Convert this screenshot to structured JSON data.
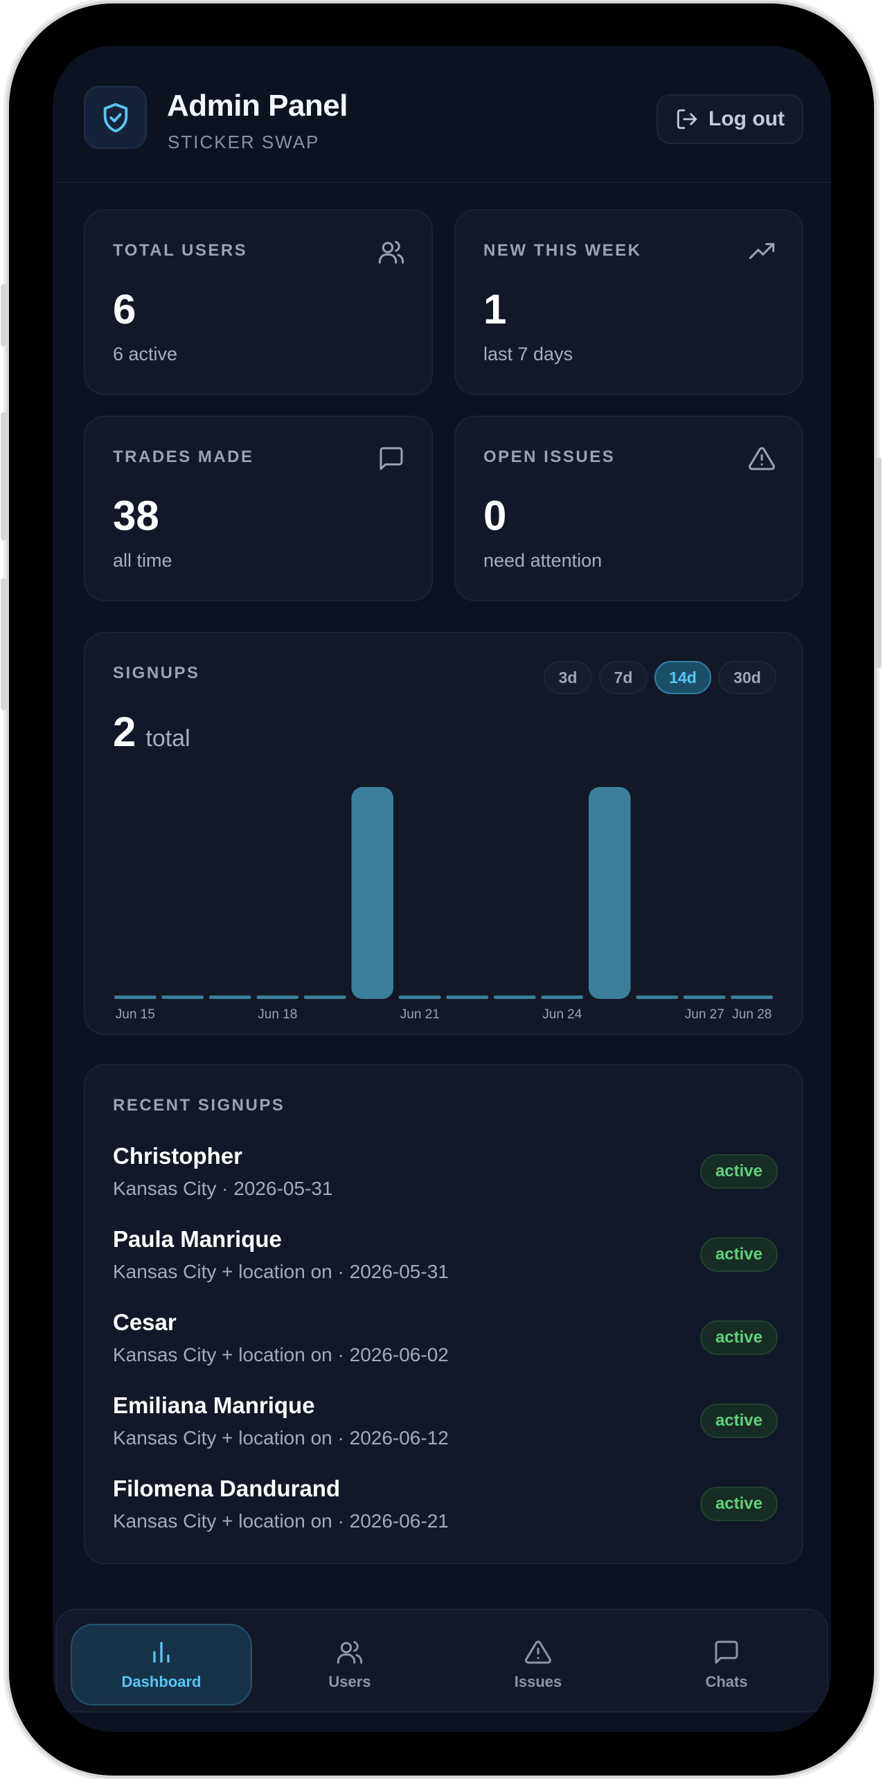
{
  "header": {
    "title": "Admin Panel",
    "subtitle": "STICKER SWAP",
    "logout_label": "Log out"
  },
  "stats": [
    {
      "label": "TOTAL USERS",
      "value": "6",
      "sub": "6 active",
      "icon": "users-icon"
    },
    {
      "label": "NEW THIS WEEK",
      "value": "1",
      "sub": "last 7 days",
      "icon": "trending-up-icon"
    },
    {
      "label": "TRADES MADE",
      "value": "38",
      "sub": "all time",
      "icon": "chat-icon"
    },
    {
      "label": "OPEN ISSUES",
      "value": "0",
      "sub": "need attention",
      "icon": "alert-triangle-icon"
    }
  ],
  "signups": {
    "label": "SIGNUPS",
    "ranges": [
      "3d",
      "7d",
      "14d",
      "30d"
    ],
    "selected_range": "14d",
    "total_value": "2",
    "total_word": "total"
  },
  "chart_data": {
    "type": "bar",
    "categories": [
      "Jun 15",
      "Jun 16",
      "Jun 17",
      "Jun 18",
      "Jun 19",
      "Jun 20",
      "Jun 21",
      "Jun 22",
      "Jun 23",
      "Jun 24",
      "Jun 25",
      "Jun 26",
      "Jun 27",
      "Jun 28"
    ],
    "values": [
      0,
      0,
      0,
      0,
      0,
      1,
      0,
      0,
      0,
      0,
      1,
      0,
      0,
      0
    ],
    "tick_labels": [
      "Jun 15",
      "Jun 18",
      "Jun 21",
      "Jun 24",
      "Jun 27",
      "Jun 28"
    ],
    "tick_indices": [
      0,
      3,
      6,
      9,
      12,
      13
    ],
    "ylim": [
      0,
      1
    ],
    "bar_color": "#3b7f9b",
    "grid": false
  },
  "recent_signups": {
    "label": "RECENT SIGNUPS",
    "items": [
      {
        "name": "Christopher",
        "meta": "Kansas City · 2026-05-31",
        "status": "active"
      },
      {
        "name": "Paula Manrique",
        "meta": "Kansas City + location on · 2026-05-31",
        "status": "active"
      },
      {
        "name": "Cesar",
        "meta": "Kansas City + location on · 2026-06-02",
        "status": "active"
      },
      {
        "name": "Emiliana Manrique",
        "meta": "Kansas City + location on · 2026-06-12",
        "status": "active"
      },
      {
        "name": "Filomena Dandurand",
        "meta": "Kansas City + location on · 2026-06-21",
        "status": "active"
      }
    ]
  },
  "nav": [
    {
      "label": "Dashboard",
      "icon": "bar-chart-icon",
      "active": true
    },
    {
      "label": "Users",
      "icon": "users-icon",
      "active": false
    },
    {
      "label": "Issues",
      "icon": "alert-triangle-icon",
      "active": false
    },
    {
      "label": "Chats",
      "icon": "chat-icon",
      "active": false
    }
  ],
  "colors": {
    "accent": "#56c7f2",
    "background": "#0d1220",
    "card": "#121827",
    "success": "#5fd07c"
  }
}
